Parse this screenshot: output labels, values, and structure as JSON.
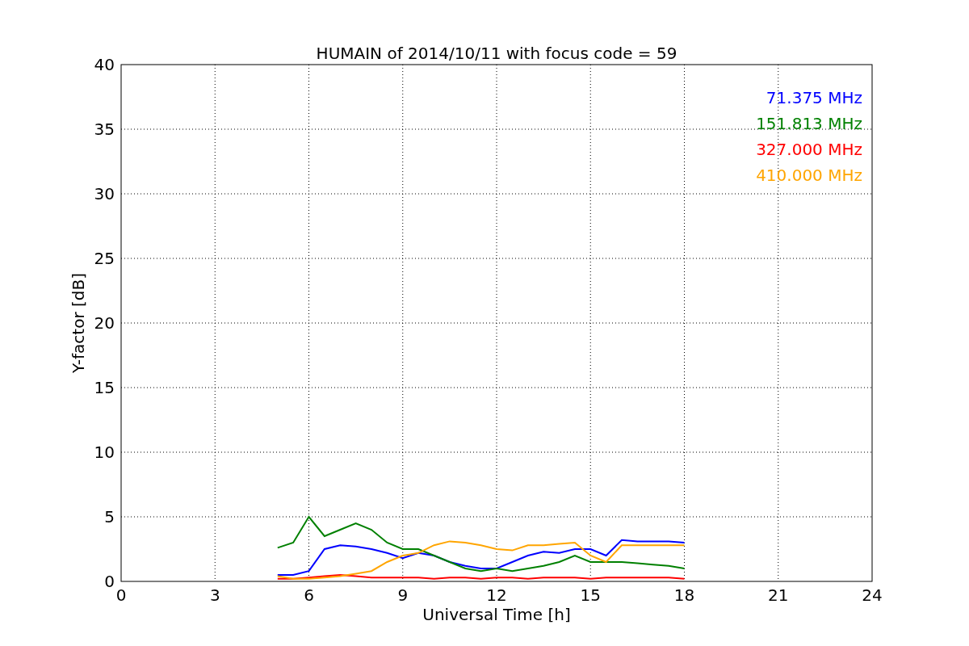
{
  "chart_data": {
    "type": "line",
    "title": "HUMAIN of 2014/10/11 with focus code = 59",
    "xlabel": "Universal Time [h]",
    "ylabel": "Y-factor [dB]",
    "x": [
      5,
      5.5,
      6,
      6.5,
      7,
      7.5,
      8,
      8.5,
      9,
      9.5,
      10,
      10.5,
      11,
      11.5,
      12,
      12.5,
      13,
      13.5,
      14,
      14.5,
      15,
      15.5,
      16,
      16.5,
      17,
      17.5,
      18
    ],
    "series": [
      {
        "name": "71.375 MHz",
        "color": "#0000ff",
        "values": [
          0.5,
          0.5,
          0.8,
          2.5,
          2.8,
          2.7,
          2.5,
          2.2,
          1.8,
          2.2,
          2.0,
          1.5,
          1.2,
          1.0,
          1.0,
          1.5,
          2.0,
          2.3,
          2.2,
          2.5,
          2.5,
          2.0,
          3.2,
          3.1,
          3.1,
          3.1,
          3.0
        ]
      },
      {
        "name": "151.813 MHz",
        "color": "#008000",
        "values": [
          2.6,
          3.0,
          5.0,
          3.5,
          4.0,
          4.5,
          4.0,
          3.0,
          2.5,
          2.5,
          2.0,
          1.5,
          1.0,
          0.8,
          1.0,
          0.8,
          1.0,
          1.2,
          1.5,
          2.0,
          1.5,
          1.5,
          1.5,
          1.4,
          1.3,
          1.2,
          1.0
        ]
      },
      {
        "name": "327.000 MHz",
        "color": "#ff0000",
        "values": [
          0.2,
          0.2,
          0.3,
          0.4,
          0.5,
          0.4,
          0.3,
          0.3,
          0.3,
          0.3,
          0.2,
          0.3,
          0.3,
          0.2,
          0.3,
          0.3,
          0.2,
          0.3,
          0.3,
          0.3,
          0.2,
          0.3,
          0.3,
          0.3,
          0.3,
          0.3,
          0.2
        ]
      },
      {
        "name": "410.000 MHz",
        "color": "#ffa500",
        "values": [
          0.4,
          0.2,
          0.2,
          0.3,
          0.4,
          0.6,
          0.8,
          1.5,
          2.0,
          2.2,
          2.8,
          3.1,
          3.0,
          2.8,
          2.5,
          2.4,
          2.8,
          2.8,
          2.9,
          3.0,
          2.0,
          1.5,
          2.8,
          2.8,
          2.8,
          2.8,
          2.8
        ]
      }
    ],
    "grid": true,
    "xlim": [
      0,
      24
    ],
    "ylim": [
      0,
      40
    ],
    "xticks": [
      0,
      3,
      6,
      9,
      12,
      15,
      18,
      21,
      24
    ],
    "yticks": [
      0,
      5,
      10,
      15,
      20,
      25,
      30,
      35,
      40
    ]
  }
}
